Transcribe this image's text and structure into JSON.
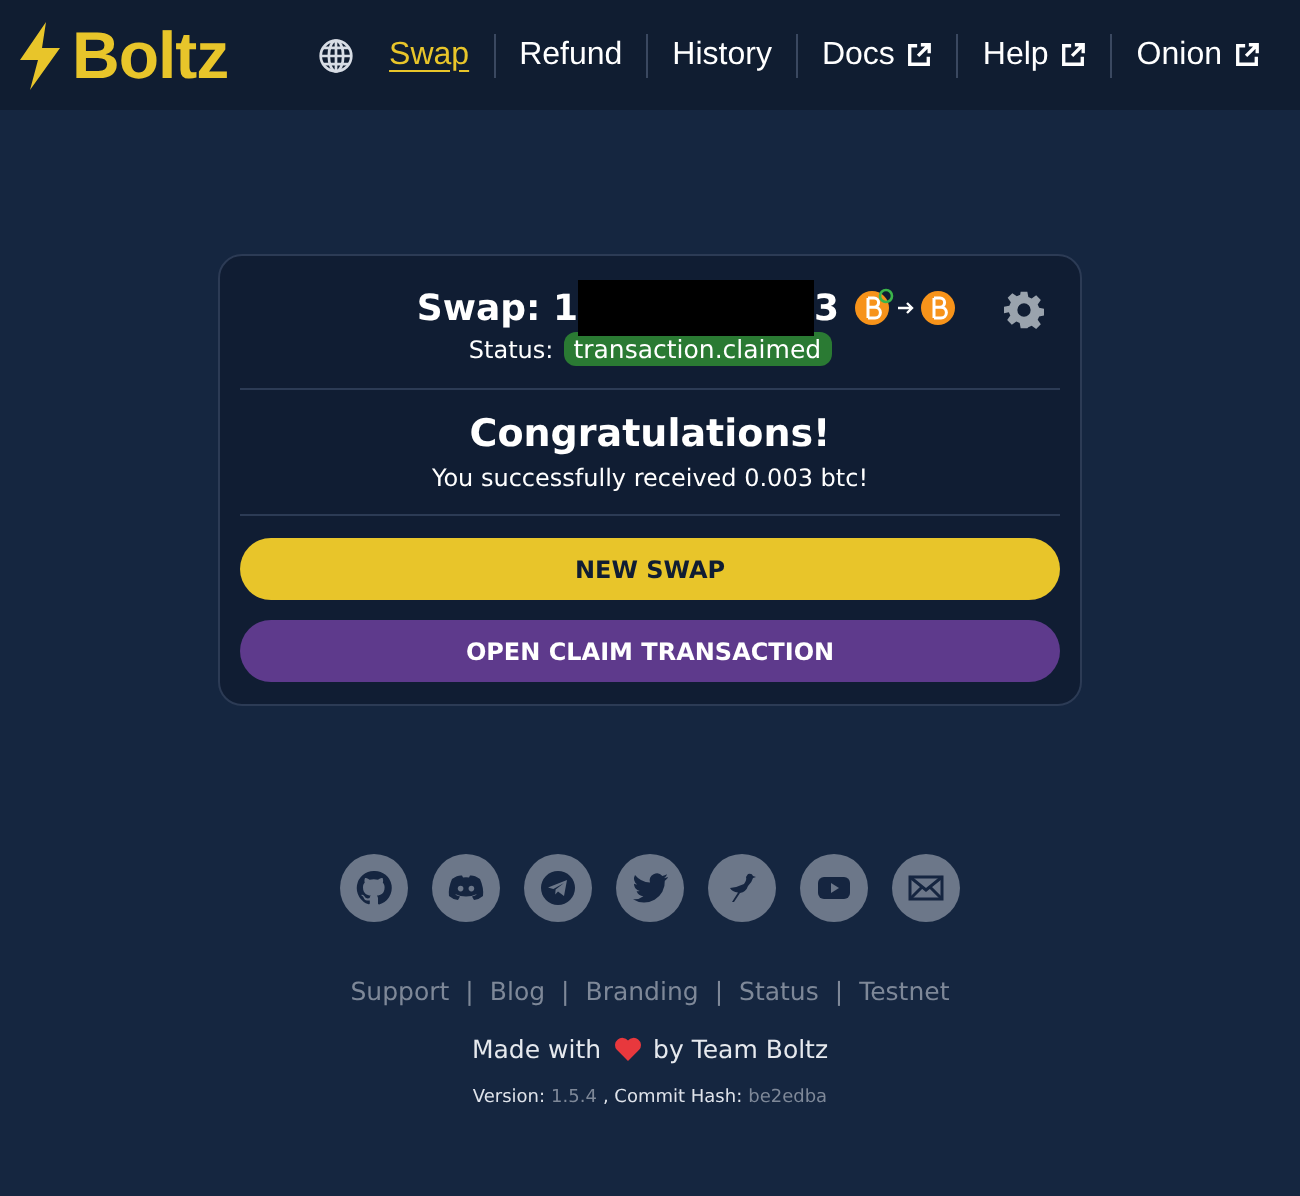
{
  "header": {
    "logo": "Boltz",
    "nav": [
      {
        "label": "Swap",
        "selected": true,
        "external": false
      },
      {
        "label": "Refund",
        "selected": false,
        "external": false
      },
      {
        "label": "History",
        "selected": false,
        "external": false
      },
      {
        "label": "Docs",
        "selected": false,
        "external": true
      },
      {
        "label": "Help",
        "selected": false,
        "external": true
      },
      {
        "label": "Onion",
        "selected": false,
        "external": true
      }
    ]
  },
  "card": {
    "title_prefix": "Swap: 1",
    "title_suffix": "3",
    "status_label": "Status:",
    "status": "transaction.claimed",
    "heading": "Congratulations!",
    "message": "You successfully received 0.003 btc!",
    "buttons": [
      {
        "label": "NEW SWAP",
        "kind": "primary"
      },
      {
        "label": "OPEN CLAIM TRANSACTION",
        "kind": "secondary"
      }
    ]
  },
  "footer": {
    "socials": [
      {
        "kind": "github"
      },
      {
        "kind": "discord"
      },
      {
        "kind": "telegram"
      },
      {
        "kind": "twitter"
      },
      {
        "kind": "nostr"
      },
      {
        "kind": "youtube"
      },
      {
        "kind": "email"
      }
    ],
    "links": [
      "Support",
      "Blog",
      "Branding",
      "Status",
      "Testnet"
    ],
    "link_separator": "|",
    "made_with": "Made with",
    "made_by": "by Team Boltz",
    "version_label": "Version:",
    "version": "1.5.4",
    "hash_label": ", Commit Hash:",
    "hash": "be2edba"
  }
}
